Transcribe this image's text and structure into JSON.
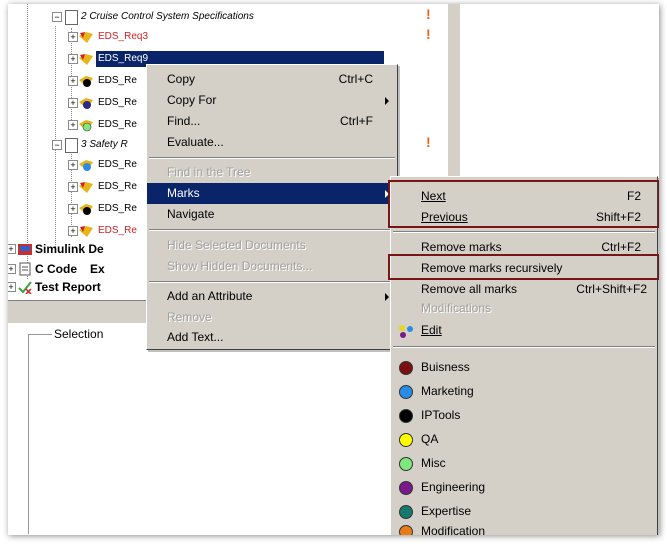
{
  "tree": {
    "section2": {
      "label": "2 Cruise Control System Specifications"
    },
    "section2_items": [
      {
        "label": "EDS_Req3",
        "color": "red",
        "flag": true
      },
      {
        "label": "EDS_Req9",
        "color": "selected",
        "flag": false
      },
      {
        "label": "EDS_Re",
        "color": "black",
        "flag": false
      },
      {
        "label": "EDS_Re",
        "color": "black",
        "flag": false
      },
      {
        "label": "EDS_Re",
        "color": "black",
        "flag": false
      }
    ],
    "section3": {
      "label": "3 Safety R"
    },
    "section3_items": [
      {
        "label": "EDS_Re",
        "color": "black"
      },
      {
        "label": "EDS_Re",
        "color": "black"
      },
      {
        "label": "EDS_Re",
        "color": "black"
      },
      {
        "label": "EDS_Re",
        "color": "red"
      }
    ],
    "root_items": [
      {
        "label": "Simulink De"
      },
      {
        "label": "C Code",
        "suffix": "Ex"
      },
      {
        "label": "Test Report"
      }
    ]
  },
  "selection_label": "Selection",
  "context_menu": {
    "items": [
      {
        "label": "Copy",
        "shortcut": "Ctrl+C"
      },
      {
        "label": "Copy For",
        "submenu": true
      },
      {
        "label": "Find...",
        "shortcut": "Ctrl+F"
      },
      {
        "label": "Evaluate..."
      },
      {
        "label": "Find in the Tree",
        "disabled": true
      },
      {
        "label": "Marks",
        "submenu": true,
        "active": true
      },
      {
        "label": "Navigate"
      },
      {
        "label": "Hide Selected Documents",
        "disabled": true
      },
      {
        "label": "Show Hidden Documents...",
        "disabled": true
      },
      {
        "label": "Add an Attribute",
        "submenu": true
      },
      {
        "label": "Remove",
        "disabled": true
      },
      {
        "label": "Add Text..."
      }
    ]
  },
  "marks_submenu": {
    "next": {
      "label": "Next",
      "shortcut": "F2"
    },
    "previous": {
      "label": "Previous",
      "shortcut": "Shift+F2"
    },
    "remove_marks": {
      "label": "Remove marks",
      "shortcut": "Ctrl+F2"
    },
    "remove_recursive": {
      "label": "Remove marks recursively"
    },
    "remove_all": {
      "label": "Remove all marks",
      "shortcut": "Ctrl+Shift+F2"
    },
    "modifications": {
      "label": "Modifications",
      "disabled": true
    },
    "edit": {
      "label": "Edit"
    },
    "marks": [
      {
        "label": "Buisness",
        "color": "#7b1010"
      },
      {
        "label": "Marketing",
        "color": "#2b8ce8"
      },
      {
        "label": "IPTools",
        "color": "#000000"
      },
      {
        "label": "QA",
        "color": "#ffff00"
      },
      {
        "label": "Misc",
        "color": "#7ee87e"
      },
      {
        "label": "Engineering",
        "color": "#7a1a8a"
      },
      {
        "label": "Expertise",
        "color": "#157a6e"
      },
      {
        "label": "Modification",
        "color": "#e87a1a"
      }
    ]
  }
}
